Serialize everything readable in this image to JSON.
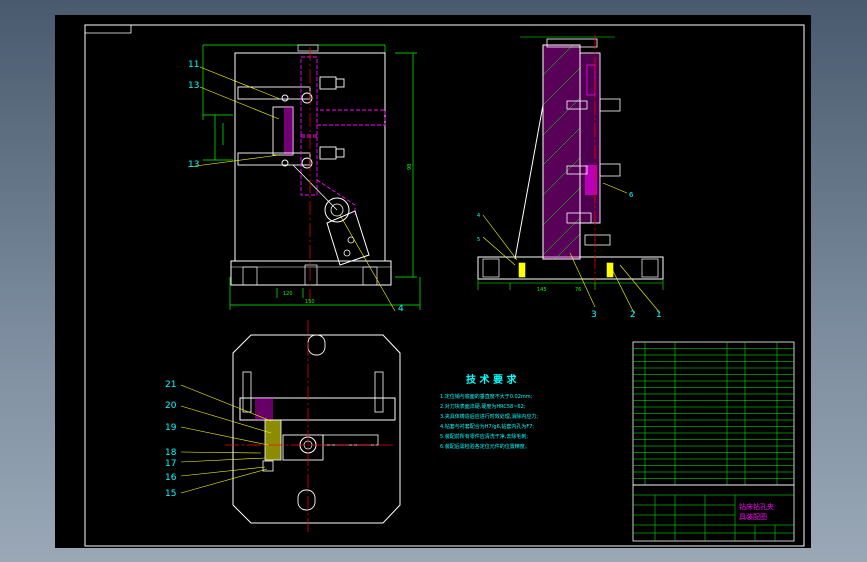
{
  "colors": {
    "background": "#000000",
    "outline": "#ffffff",
    "dimension": "#00ff00",
    "centerline": "#ff0000",
    "hidden": "#ff00ff",
    "fastener": "#00ffff",
    "hatch": "#ff00ff",
    "text": "#00ffff",
    "leader": "#ffff00"
  },
  "front_view": {
    "balloons": [
      "11",
      "13",
      "13"
    ],
    "dims": {
      "height": "98",
      "width": "150",
      "base": "120"
    }
  },
  "side_view": {
    "balloons": [
      "4",
      "5",
      "6",
      "3",
      "2",
      "1"
    ]
  },
  "top_view": {
    "balloons": [
      "21",
      "20",
      "19",
      "18",
      "17",
      "16",
      "15"
    ]
  },
  "notes": {
    "title": "技 术 要 求",
    "items": [
      "1.定位销与底面的垂直度不大于0.02mm;",
      "2.对刀块表面淬硬,硬度为HRC58~62;",
      "3.夹具体铸造后应进行时效处理,消除内应力;",
      "4.钻套与衬套配合为H7/g6,钻套内孔为F7;",
      "5.装配前所有零件应清洗干净,去除毛刺;",
      "6.装配后需检验各定位元件的位置精度。"
    ]
  },
  "title_block": {
    "drawing_name_line1": "钻床钻孔夹",
    "drawing_name_line2": "具装配图"
  }
}
